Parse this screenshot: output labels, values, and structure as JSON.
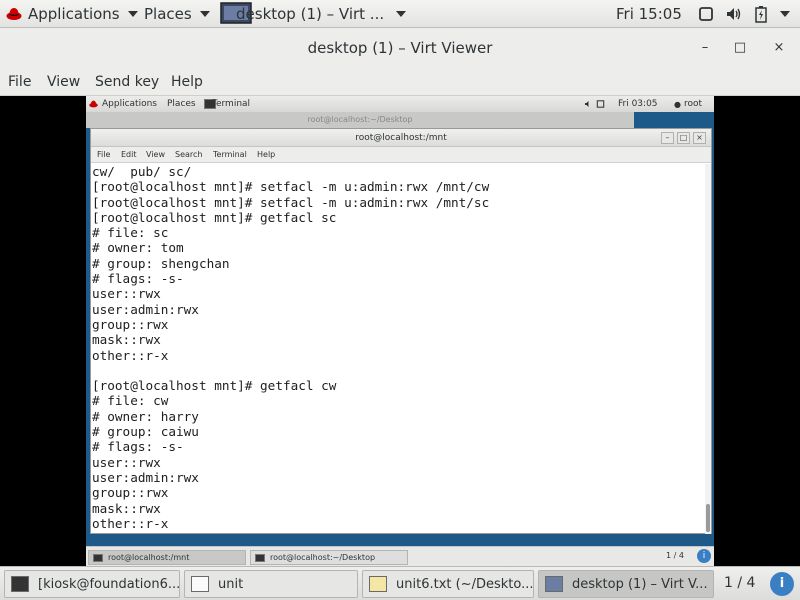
{
  "host_panel": {
    "applications": "Applications",
    "places": "Places",
    "active_window": "desktop (1) – Virt ...",
    "clock": "Fri 15:05"
  },
  "viewer": {
    "title": "desktop (1) – Virt Viewer",
    "menu": [
      "File",
      "View",
      "Send key",
      "Help"
    ],
    "minimize": "–",
    "maximize": "□",
    "close": "×"
  },
  "guest_panel": {
    "applications": "Applications",
    "places": "Places",
    "terminal": "Terminal",
    "clock": "Fri 03:05",
    "user": "root"
  },
  "guest_bg_window_title": "root@localhost:~/Desktop",
  "terminal": {
    "title": "root@localhost:/mnt",
    "menu": [
      "File",
      "Edit",
      "View",
      "Search",
      "Terminal",
      "Help"
    ],
    "lines": [
      "cw/  pub/ sc/",
      "[root@localhost mnt]# setfacl -m u:admin:rwx /mnt/cw",
      "[root@localhost mnt]# setfacl -m u:admin:rwx /mnt/sc",
      "[root@localhost mnt]# getfacl sc",
      "# file: sc",
      "# owner: tom",
      "# group: shengchan",
      "# flags: -s-",
      "user::rwx",
      "user:admin:rwx",
      "group::rwx",
      "mask::rwx",
      "other::r-x",
      "",
      "[root@localhost mnt]# getfacl cw",
      "# file: cw",
      "# owner: harry",
      "# group: caiwu",
      "# flags: -s-",
      "user::rwx",
      "user:admin:rwx",
      "group::rwx",
      "mask::rwx",
      "other::r-x"
    ]
  },
  "guest_taskbar": {
    "items": [
      "root@localhost:/mnt",
      "root@localhost:~/Desktop"
    ],
    "workspace": "1 / 4"
  },
  "host_taskbar": {
    "items": [
      "[kiosk@foundation6...",
      "unit",
      "unit6.txt (~/Deskto...",
      "desktop (1) – Virt V..."
    ],
    "workspace": "1 / 4"
  }
}
